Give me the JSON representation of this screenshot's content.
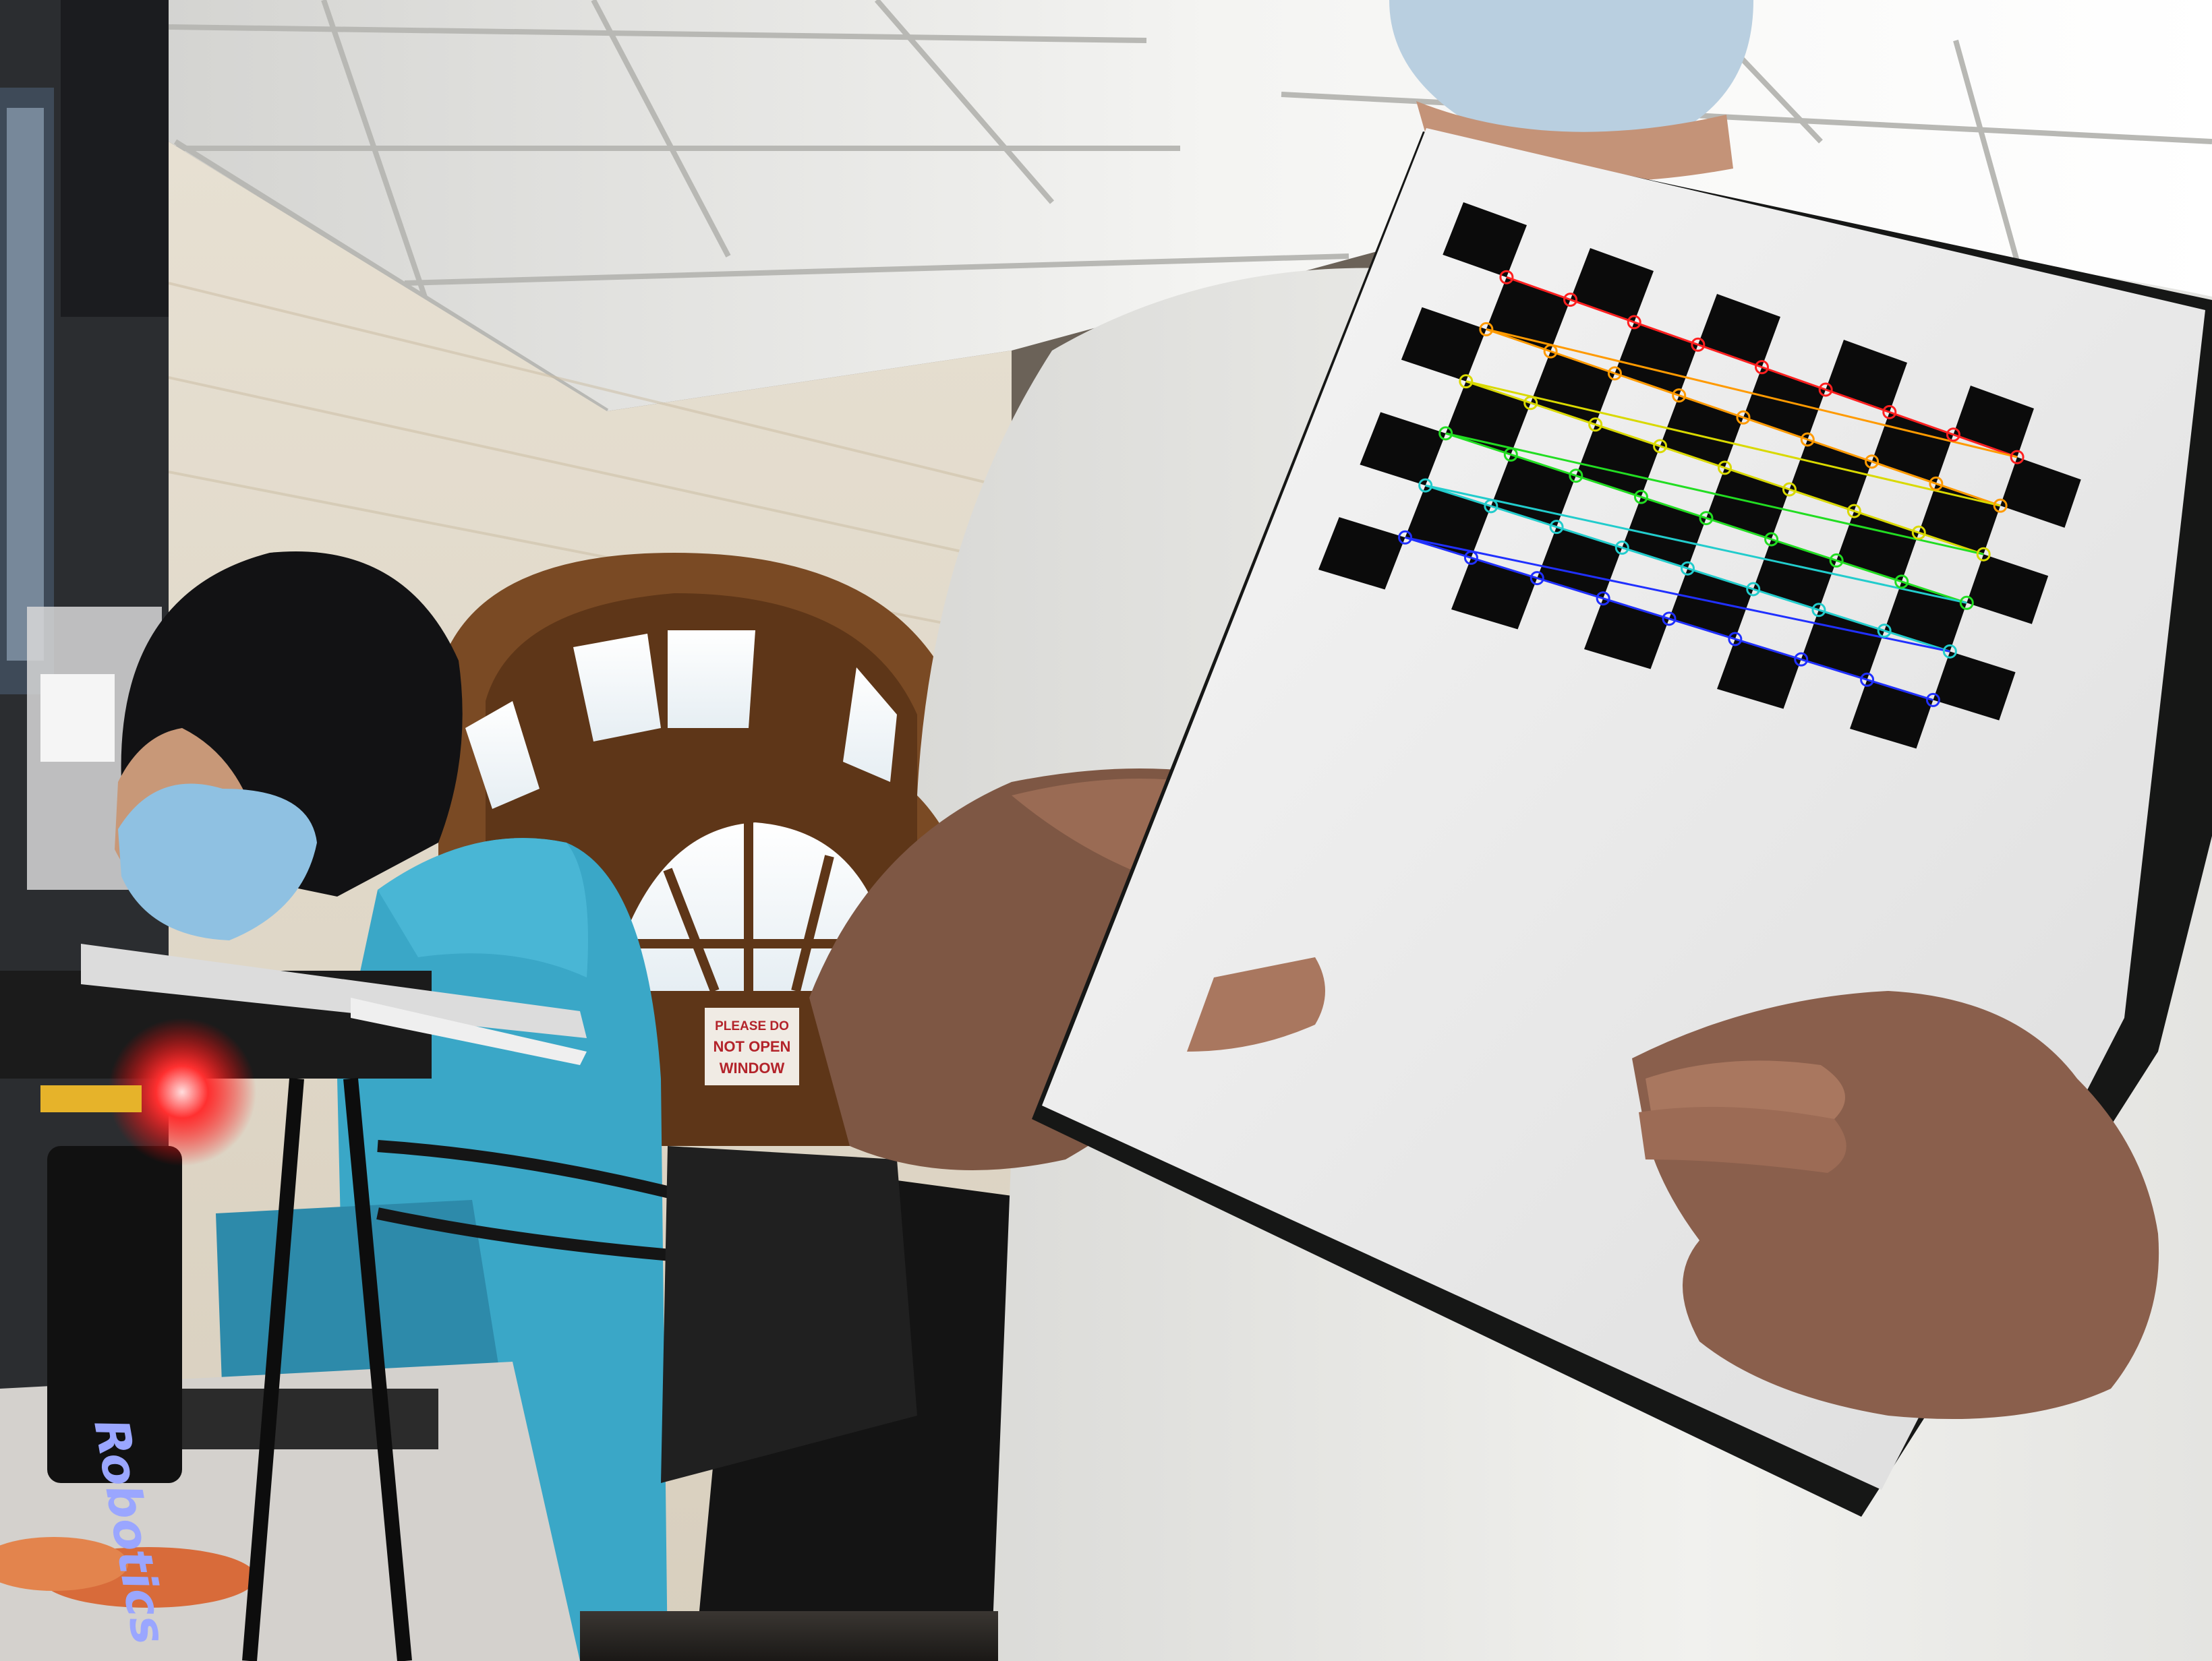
{
  "scene": {
    "description_tags": [
      "lab",
      "checkerboard-calibration",
      "drone",
      "window"
    ]
  },
  "window_sign": {
    "line1": "PLEASE DO",
    "line2": "NOT OPEN",
    "line3": "WINDOW"
  },
  "drone_label": {
    "text": "Robotics"
  },
  "calibration": {
    "rows": 6,
    "cols": 9,
    "row_colors": [
      "#ff2020",
      "#ff9a00",
      "#d9d900",
      "#22dd22",
      "#22cccc",
      "#2030ff"
    ]
  },
  "colors": {
    "ceiling": "#e7e7e4",
    "wall": "#ebe4d6",
    "window_frame": "#7a4a24",
    "shirt_blue": "#3aa7c7",
    "board_white": "#f2f2f2",
    "board_black": "#0b0b0b"
  }
}
